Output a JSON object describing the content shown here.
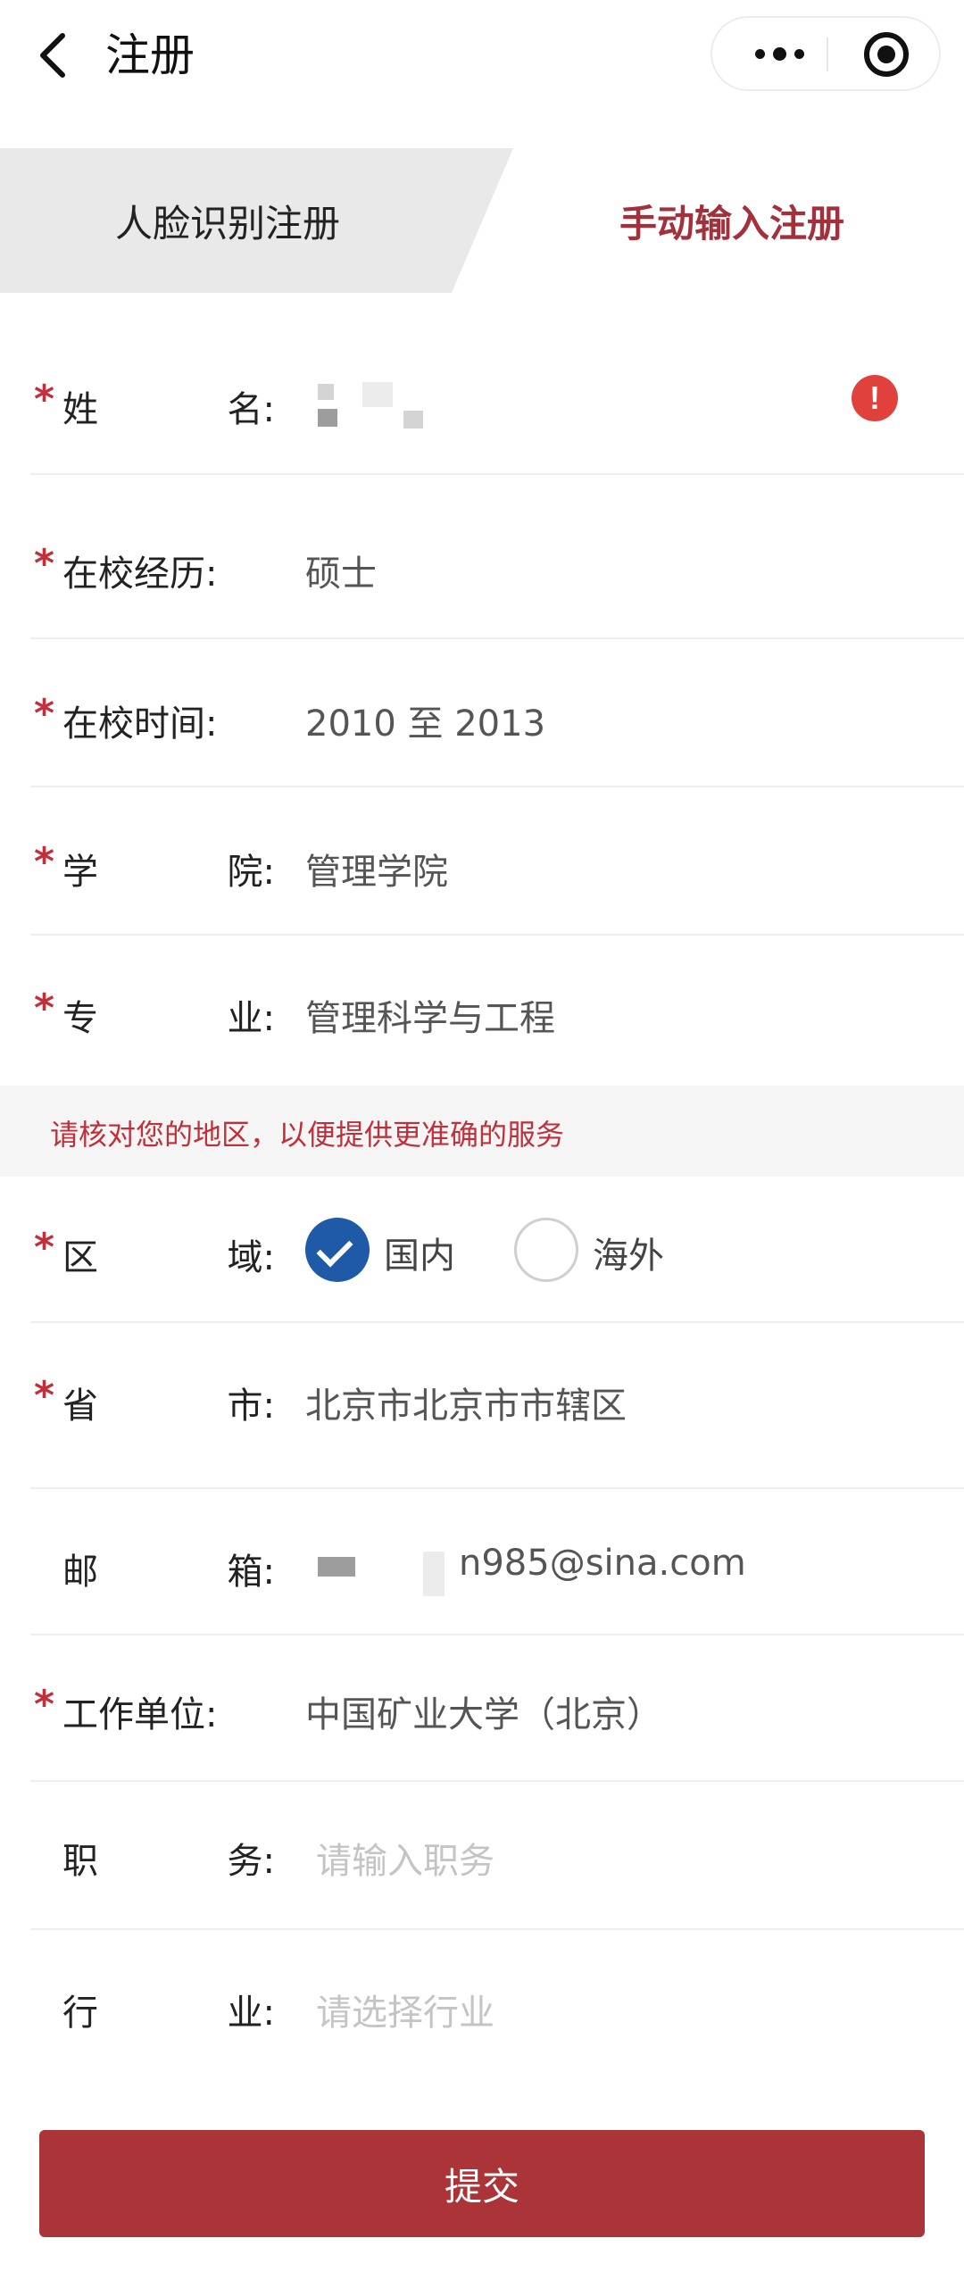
{
  "nav": {
    "title": "注册"
  },
  "tabs": {
    "face": "人脸识别注册",
    "manual": "手动输入注册"
  },
  "form": {
    "name": {
      "label_a": "姓",
      "label_b": "名:"
    },
    "degree": {
      "label": "在校经历:",
      "value": "硕士"
    },
    "period": {
      "label": "在校时间:",
      "value": "2010 至 2013"
    },
    "college": {
      "label_a": "学",
      "label_b": "院:",
      "value": "管理学院"
    },
    "major": {
      "label_a": "专",
      "label_b": "业:",
      "value": "管理科学与工程"
    },
    "notice": "请核对您的地区，以便提供更准确的服务",
    "region": {
      "label_a": "区",
      "label_b": "域:",
      "option_domestic": "国内",
      "option_overseas": "海外",
      "selected": "国内"
    },
    "province": {
      "label_a": "省",
      "label_b": "市:",
      "value": "北京市北京市市辖区"
    },
    "email": {
      "label_a": "邮",
      "label_b": "箱:",
      "value_visible": "n985@sina.com"
    },
    "employer": {
      "label": "工作单位:",
      "value": "中国矿业大学（北京）"
    },
    "position": {
      "label_a": "职",
      "label_b": "务:",
      "placeholder": "请输入职务"
    },
    "industry": {
      "label_a": "行",
      "label_b": "业:",
      "placeholder": "请选择行业"
    }
  },
  "submit_label": "提交",
  "colors": {
    "brand_red": "#ab3438",
    "required_star": "#c0303a",
    "radio_checked": "#1e5aa8",
    "alert": "#e0413d"
  },
  "icons": {
    "back": "chevron-left-icon",
    "more": "more-dots-icon",
    "close": "target-circle-icon",
    "alert": "exclamation-circle-icon",
    "check": "checkmark-icon"
  }
}
